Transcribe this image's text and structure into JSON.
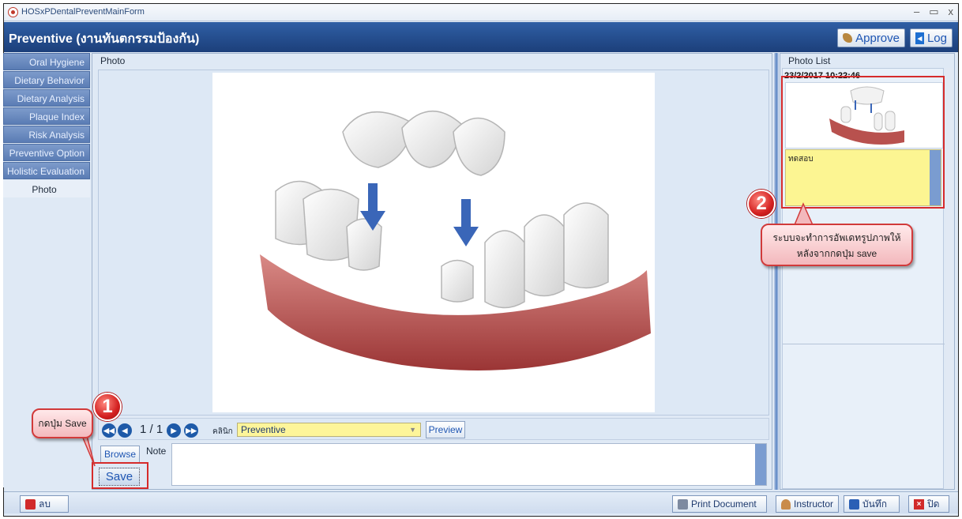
{
  "window": {
    "title": "HOSxPDentalPreventMainForm",
    "controls": [
      "–",
      "▭",
      "x"
    ]
  },
  "header": {
    "title": "Preventive (งานทันตกรรมป้องกัน)",
    "approve_label": "Approve",
    "log_label": "Log"
  },
  "sidebar": {
    "items": [
      {
        "label": "Oral Hygiene"
      },
      {
        "label": "Dietary Behavior"
      },
      {
        "label": "Dietary Analysis"
      },
      {
        "label": "Plaque Index"
      },
      {
        "label": "Risk Analysis"
      },
      {
        "label": "Preventive Option"
      },
      {
        "label": "Holistic Evaluation"
      },
      {
        "label": "Photo"
      }
    ],
    "active": "Photo"
  },
  "photo_panel": {
    "label": "Photo",
    "page_indicator": "1 / 1",
    "clinic_label": "คลินิก",
    "clinic_value": "Preventive",
    "preview_label": "Preview",
    "browse_label": "Browse",
    "note_label": "Note",
    "note_value": "",
    "save_label": "Save"
  },
  "photo_list": {
    "label": "Photo List",
    "items": [
      {
        "date": "23/2/2017 10:22:46",
        "caption": "ทดสอบ"
      }
    ]
  },
  "callouts": {
    "step1": {
      "number": "1",
      "text": "กดปุ่ม Save"
    },
    "step2": {
      "number": "2",
      "line1": "ระบบจะทำการอัพเดทรูปภาพให้",
      "line2": "หลังจากกดปุ่ม save"
    }
  },
  "statusbar": {
    "delete_label": "ลบ",
    "print_label": "Print Document",
    "instructor_label": "Instructor",
    "save_label": "บันทึก",
    "close_label": "ปิด"
  },
  "colors": {
    "header": "#1c3f7a",
    "highlight": "#d62b2b",
    "clinic_field": "#fdf59a",
    "caption_field": "#fcf592"
  }
}
